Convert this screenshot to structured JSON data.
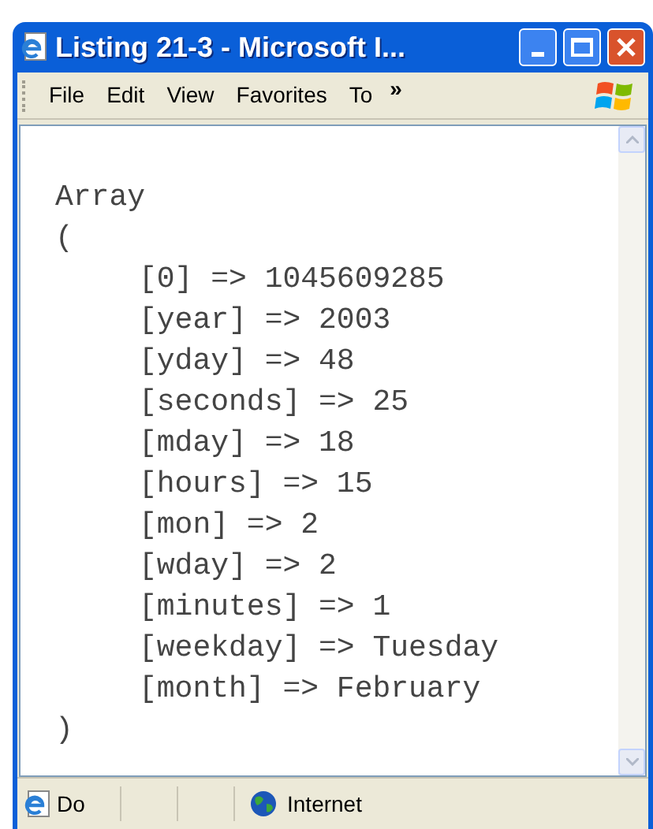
{
  "window": {
    "title": "Listing 21-3 - Microsoft I..."
  },
  "menu": [
    {
      "label": "File"
    },
    {
      "label": "Edit"
    },
    {
      "label": "View"
    },
    {
      "label": "Favorites"
    },
    {
      "label": "To"
    }
  ],
  "menu_overflow": "»",
  "content": {
    "lines": [
      {
        "text": "Array"
      },
      {
        "text": "(",
        "children": [
          {
            "text": "[0] => 1045609285"
          },
          {
            "text": "[year] => 2003"
          },
          {
            "text": "[yday] => 48"
          },
          {
            "text": "[seconds] => 25"
          },
          {
            "text": "[mday] => 18"
          },
          {
            "text": "[hours] => 15"
          },
          {
            "text": "[mon] => 2"
          },
          {
            "text": "[wday] => 2"
          },
          {
            "text": "[minutes] => 1"
          },
          {
            "text": "[weekday] => Tuesday"
          },
          {
            "text": "[month] => February"
          }
        ]
      },
      {
        "text": ")"
      }
    ]
  },
  "status_bar": {
    "status": "Do",
    "zone": "Internet"
  }
}
